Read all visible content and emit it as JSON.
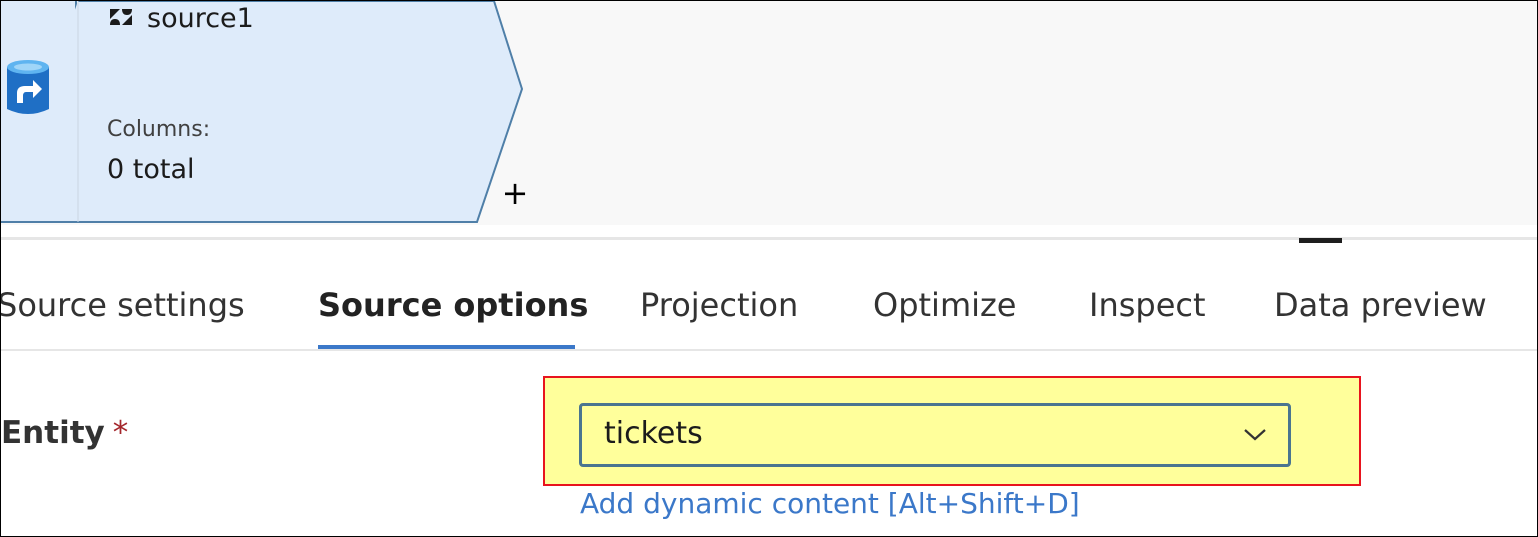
{
  "node": {
    "name": "source1",
    "columns_label": "Columns:",
    "columns_value": "0 total",
    "add_label": "+"
  },
  "tabs": [
    {
      "label": "Source settings",
      "active": false
    },
    {
      "label": "Source options",
      "active": true
    },
    {
      "label": "Projection",
      "active": false
    },
    {
      "label": "Optimize",
      "active": false
    },
    {
      "label": "Inspect",
      "active": false
    },
    {
      "label": "Data preview",
      "active": false
    }
  ],
  "entity": {
    "label": "Entity",
    "required_marker": "*",
    "value": "tickets",
    "dynamic_link": "Add dynamic content [Alt+Shift+D]"
  },
  "icons": {
    "node_type": "zendesk-icon",
    "left_dataset": "database-redirect-icon",
    "dropdown": "chevron-down-icon"
  },
  "colors": {
    "accent": "#3b78c9",
    "highlight": "#ffff9b",
    "highlight_border": "#e8141e",
    "node_fill": "#deebfa",
    "node_border": "#4f7fa8",
    "required": "#a4262c"
  }
}
